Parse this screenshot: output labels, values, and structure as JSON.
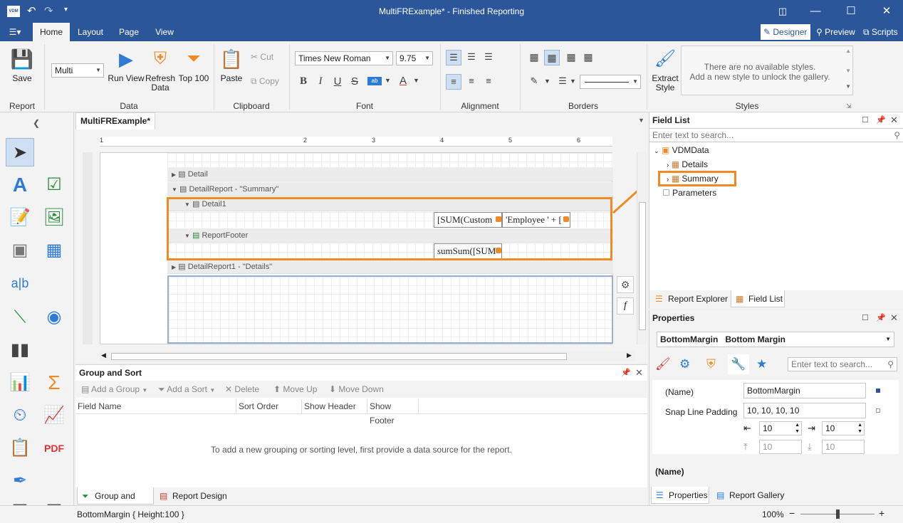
{
  "window": {
    "title": "MultiFRExample* - Finished Reporting",
    "app_logo": "VDM"
  },
  "tabs": [
    "Home",
    "Layout",
    "Page",
    "View"
  ],
  "modes": {
    "designer": "Designer",
    "preview": "Preview",
    "scripts": "Scripts"
  },
  "ribbon": {
    "report": {
      "save": "Save",
      "group": "Report"
    },
    "data": {
      "combo": "Multi",
      "run_view": "Run View",
      "refresh_data": "Refresh\nData",
      "top100": "Top 100",
      "group": "Data"
    },
    "clipboard": {
      "paste": "Paste",
      "cut": "Cut",
      "copy": "Copy",
      "group": "Clipboard"
    },
    "font": {
      "family": "Times New Roman",
      "size": "9.75",
      "group": "Font",
      "bold": "B",
      "italic": "I",
      "underline": "U",
      "strike": "S"
    },
    "alignment": {
      "group": "Alignment"
    },
    "borders": {
      "group": "Borders"
    },
    "styles": {
      "extract": "Extract\nStyle",
      "empty_line1": "There are no available styles.",
      "empty_line2": "Add a new style to unlock the gallery.",
      "group": "Styles"
    }
  },
  "document": {
    "tab": "MultiFRExample*"
  },
  "ruler": [
    "1",
    "2",
    "3",
    "4",
    "5",
    "6"
  ],
  "bands": {
    "detail": "Detail",
    "detail_report_summary": "DetailReport - \"Summary\"",
    "detail1": "Detail1",
    "report_footer": "ReportFooter",
    "detail_report1": "DetailReport1 - \"Details\""
  },
  "cells": {
    "sum_customer": "[SUM(Custom",
    "employee": "'Employee ' + [",
    "sum_sum": "sumSum([SUM"
  },
  "group_sort": {
    "title": "Group and Sort",
    "add_group": "Add a Group",
    "add_sort": "Add a Sort",
    "delete": "Delete",
    "move_up": "Move Up",
    "move_down": "Move Down",
    "columns": [
      "Field Name",
      "Sort Order",
      "Show Header",
      "Show Footer"
    ],
    "empty": "To add a new grouping or sorting level, first provide a data source for the report.",
    "tab1": "Group and Sort",
    "tab2": "Report Design Analyzer"
  },
  "field_list": {
    "title": "Field List",
    "search_placeholder": "Enter text to search...",
    "root": "VDMData",
    "items": [
      "Details",
      "Summary"
    ],
    "parameters": "Parameters",
    "tab1": "Report Explorer",
    "tab2": "Field List"
  },
  "properties": {
    "title": "Properties",
    "selected_name": "BottomMargin",
    "selected_type": "Bottom Margin",
    "search_placeholder": "Enter text to search...",
    "name_label": "(Name)",
    "name_value": "BottomMargin",
    "snap_label": "Snap Line Padding",
    "snap_value": "10, 10, 10, 10",
    "pad_left": "10",
    "pad_right": "10",
    "pad_top": "10",
    "pad_bottom": "10",
    "desc_title": "(Name)",
    "tab1": "Properties",
    "tab2": "Report Gallery"
  },
  "status": {
    "text": "BottomMargin { Height:100 }",
    "zoom": "100%"
  },
  "colors": {
    "accent": "#2b579a",
    "highlight": "#f08a24"
  }
}
